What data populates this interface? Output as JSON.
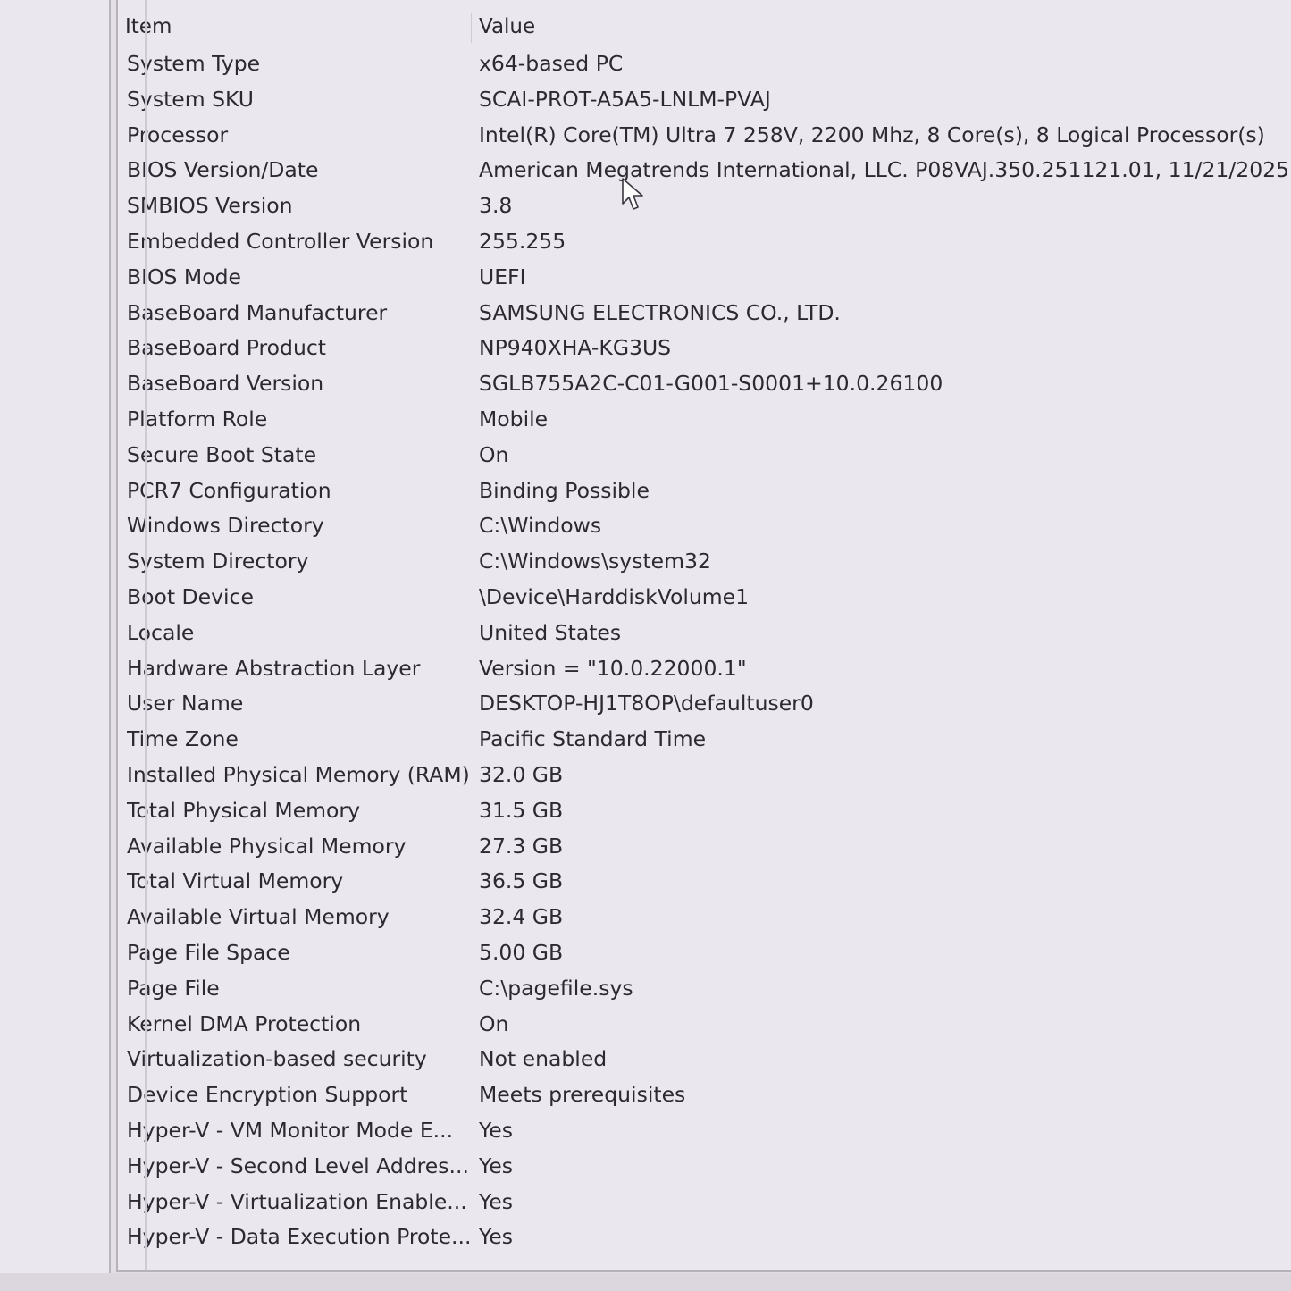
{
  "columns": {
    "item": "Item",
    "value": "Value"
  },
  "rows": [
    {
      "item": "System Type",
      "value": "x64-based PC"
    },
    {
      "item": "System SKU",
      "value": "SCAI-PROT-A5A5-LNLM-PVAJ"
    },
    {
      "item": "Processor",
      "value": "Intel(R) Core(TM) Ultra 7 258V, 2200 Mhz, 8 Core(s), 8 Logical Processor(s)"
    },
    {
      "item": "BIOS Version/Date",
      "value": "American Megatrends International, LLC. P08VAJ.350.251121.01, 11/21/2025"
    },
    {
      "item": "SMBIOS Version",
      "value": "3.8"
    },
    {
      "item": "Embedded Controller Version",
      "value": "255.255"
    },
    {
      "item": "BIOS Mode",
      "value": "UEFI"
    },
    {
      "item": "BaseBoard Manufacturer",
      "value": "SAMSUNG ELECTRONICS CO., LTD."
    },
    {
      "item": "BaseBoard Product",
      "value": "NP940XHA-KG3US"
    },
    {
      "item": "BaseBoard Version",
      "value": "SGLB755A2C-C01-G001-S0001+10.0.26100"
    },
    {
      "item": "Platform Role",
      "value": "Mobile"
    },
    {
      "item": "Secure Boot State",
      "value": "On"
    },
    {
      "item": "PCR7 Configuration",
      "value": "Binding Possible"
    },
    {
      "item": "Windows Directory",
      "value": "C:\\Windows"
    },
    {
      "item": "System Directory",
      "value": "C:\\Windows\\system32"
    },
    {
      "item": "Boot Device",
      "value": "\\Device\\HarddiskVolume1"
    },
    {
      "item": "Locale",
      "value": "United States"
    },
    {
      "item": "Hardware Abstraction Layer",
      "value": "Version = \"10.0.22000.1\""
    },
    {
      "item": "User Name",
      "value": "DESKTOP-HJ1T8OP\\defaultuser0"
    },
    {
      "item": "Time Zone",
      "value": "Pacific Standard Time"
    },
    {
      "item": "Installed Physical Memory (RAM)",
      "value": "32.0 GB"
    },
    {
      "item": "Total Physical Memory",
      "value": "31.5 GB"
    },
    {
      "item": "Available Physical Memory",
      "value": "27.3 GB"
    },
    {
      "item": "Total Virtual Memory",
      "value": "36.5 GB"
    },
    {
      "item": "Available Virtual Memory",
      "value": "32.4 GB"
    },
    {
      "item": "Page File Space",
      "value": "5.00 GB"
    },
    {
      "item": "Page File",
      "value": "C:\\pagefile.sys"
    },
    {
      "item": "Kernel DMA Protection",
      "value": "On"
    },
    {
      "item": "Virtualization-based security",
      "value": "Not enabled"
    },
    {
      "item": "Device Encryption Support",
      "value": "Meets prerequisites"
    },
    {
      "item": "Hyper-V - VM Monitor Mode E...",
      "value": "Yes"
    },
    {
      "item": "Hyper-V - Second Level Addres...",
      "value": "Yes"
    },
    {
      "item": "Hyper-V - Virtualization Enable...",
      "value": "Yes"
    },
    {
      "item": "Hyper-V - Data Execution Prote...",
      "value": "Yes"
    }
  ],
  "icons": {
    "cursor": "mouse-pointer-icon"
  }
}
